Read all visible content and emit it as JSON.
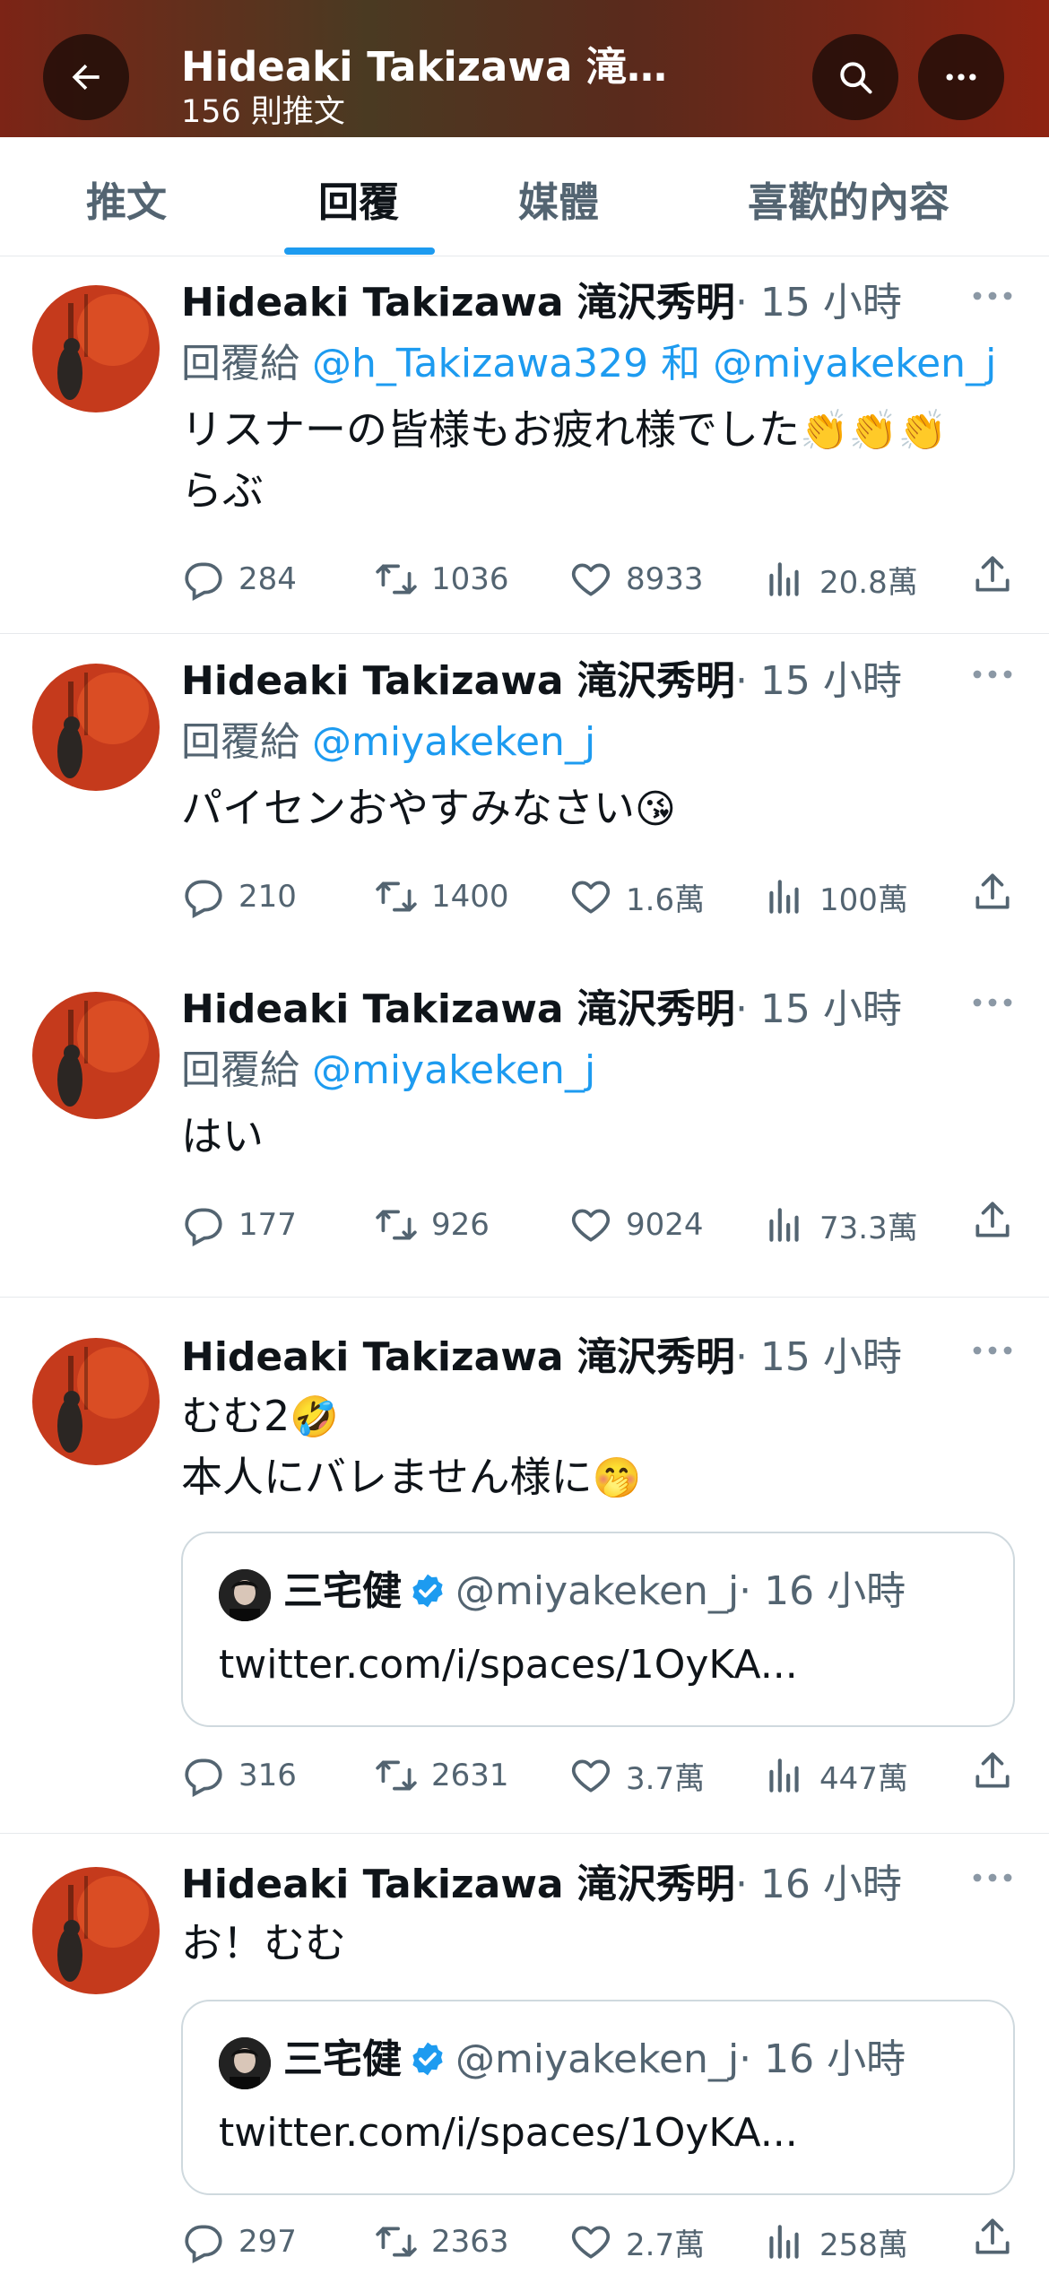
{
  "header": {
    "title": "Hideaki Takizawa 滝…",
    "subtitle": "156 則推文",
    "back_icon": "arrow-left-icon",
    "search_icon": "search-icon",
    "more_icon": "more-icon"
  },
  "tabs": [
    {
      "label": "推文"
    },
    {
      "label": "回覆",
      "active": true
    },
    {
      "label": "媒體"
    },
    {
      "label": "喜歡的內容"
    }
  ],
  "colors": {
    "accent": "#1d9bf0",
    "text": "#0f1419",
    "muted": "#536471"
  },
  "tweets": [
    {
      "name": "Hideaki Takizawa 滝沢秀明",
      "time": "· 15 小時",
      "reply_prefix": "回覆給 ",
      "reply_at1": "@h_Takizawa329",
      "reply_and": " 和 ",
      "reply_at2": "@miyakeken_j",
      "text_line1": "リスナーの皆様もお疲れ様でした",
      "emoji1": "👏👏👏",
      "text_line2": "らぶ",
      "replies": "284",
      "retweets": "1036",
      "likes": "8933",
      "views": "20.8萬"
    },
    {
      "name": "Hideaki Takizawa 滝沢秀明",
      "time": "· 15 小時",
      "reply_prefix": "回覆給 ",
      "reply_at1": "@miyakeken_j",
      "text_line1": "パイセンおやすみなさい",
      "emoji1": "😘",
      "replies": "210",
      "retweets": "1400",
      "likes": "1.6萬",
      "views": "100萬"
    },
    {
      "name": "Hideaki Takizawa 滝沢秀明",
      "time": "· 15 小時",
      "reply_prefix": "回覆給 ",
      "reply_at1": "@miyakeken_j",
      "text_line1": "はい",
      "replies": "177",
      "retweets": "926",
      "likes": "9024",
      "views": "73.3萬"
    },
    {
      "name": "Hideaki Takizawa 滝沢秀明",
      "time": "· 15 小時",
      "text_line1": "むむ2",
      "emoji1": "🤣",
      "text_line2": "本人にバレません様に",
      "emoji2": "🤭",
      "quote": {
        "name": "三宅健",
        "handle": "@miyakeken_j",
        "time": "· 16 小時",
        "text": "twitter.com/i/spaces/1OyKA..."
      },
      "replies": "316",
      "retweets": "2631",
      "likes": "3.7萬",
      "views": "447萬"
    },
    {
      "name": "Hideaki Takizawa 滝沢秀明",
      "time": "· 16 小時",
      "text_line1": "お！むむ",
      "quote": {
        "name": "三宅健",
        "handle": "@miyakeken_j",
        "time": "· 16 小時",
        "text": "twitter.com/i/spaces/1OyKA..."
      },
      "replies": "297",
      "retweets": "2363",
      "likes": "2.7萬",
      "views": "258萬"
    }
  ]
}
